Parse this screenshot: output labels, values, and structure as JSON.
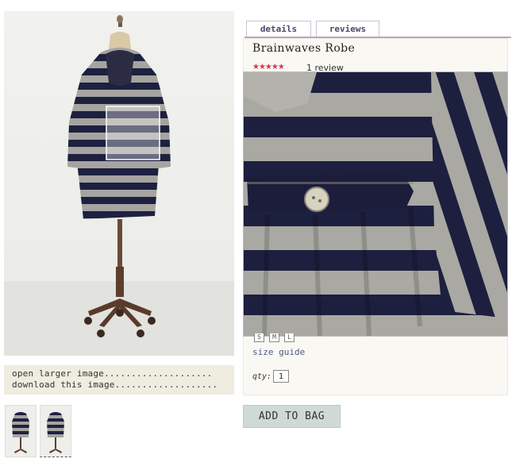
{
  "product": {
    "title": "Brainwaves Robe",
    "stars": "★★★★★",
    "rating": 5,
    "review_count": "1 review"
  },
  "tabs": [
    {
      "label": "details",
      "active": true
    },
    {
      "label": "reviews",
      "active": false
    }
  ],
  "image_links": {
    "open_larger": "open larger image....................",
    "download": "download this image..................."
  },
  "sizes": [
    "S",
    "M",
    "L"
  ],
  "size_guide": "size guide",
  "qty": {
    "label": "qty:",
    "value": "1"
  },
  "add_to_bag": "ADD TO BAG",
  "colors": {
    "navy_stripe": "#1e2040",
    "grey_stripe": "#a5a4a0",
    "rating_stars": "#d23b58",
    "link": "#4c5a86",
    "button_bg": "#cfdad6",
    "panel_bg": "#efece0"
  }
}
